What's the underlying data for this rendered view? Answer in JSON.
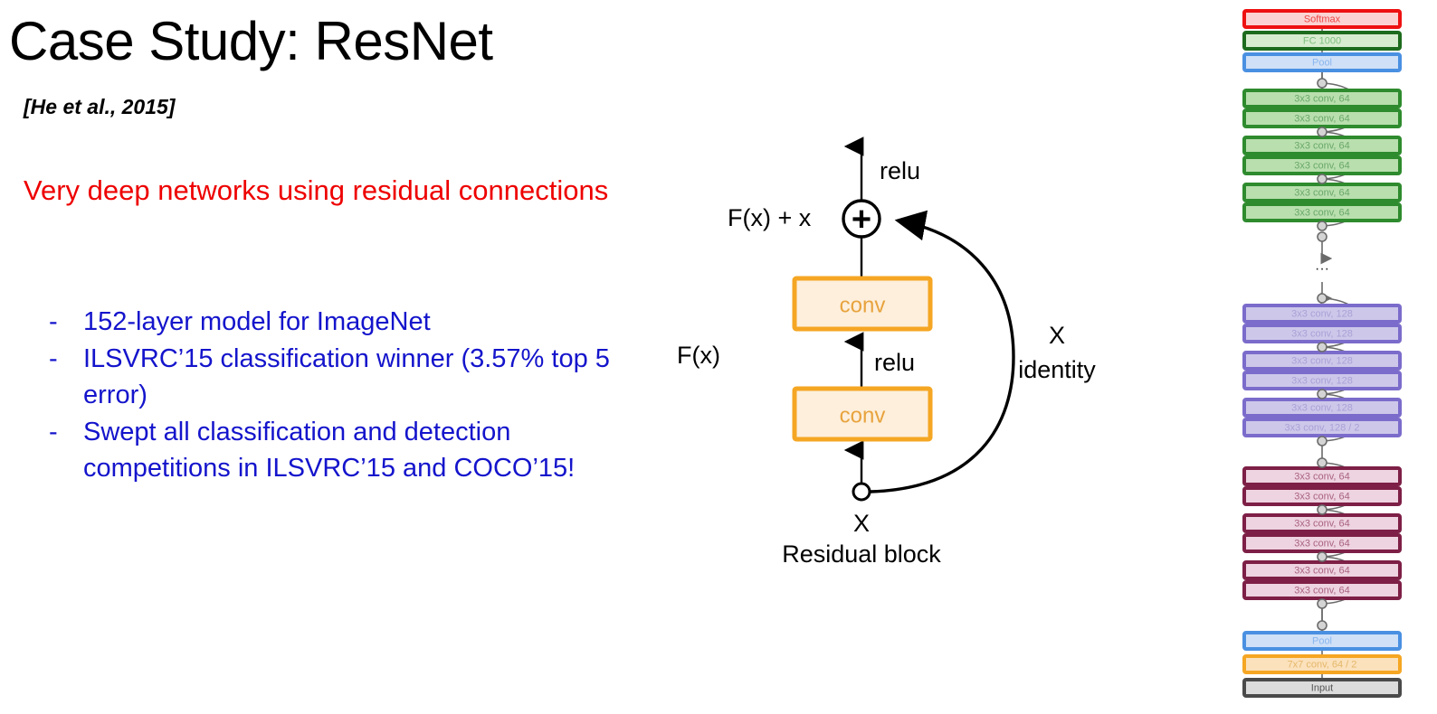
{
  "slide": {
    "title": "Case Study: ResNet",
    "citation": "[He et al., 2015]",
    "headline": "Very deep networks using residual connections",
    "bullet_marker": "-",
    "bullets": [
      "152-layer model for ImageNet",
      "ILSVRC’15 classification winner (3.57% top 5 error)",
      "Swept all classification and detection competitions in ILSVRC’15 and COCO’15!"
    ],
    "colors": {
      "title": "#000000",
      "headline": "#ee0000",
      "bullets": "#1414cc"
    }
  },
  "residual_block": {
    "caption": "Residual block",
    "input_label": "X",
    "output_relu_label": "relu",
    "mid_relu_label": "relu",
    "sum_label": "F(x) + x",
    "branch_label": "F(x)",
    "identity_label_top": "X",
    "identity_label_bottom": "identity",
    "conv_top_label": "conv",
    "conv_bottom_label": "conv",
    "plus_glyph": "+",
    "colors": {
      "conv_border": "#f5a623",
      "conv_fill": "#fdefdc",
      "conv_text": "#e8a33d",
      "line": "#000000"
    }
  },
  "architecture": {
    "ellipsis": "···",
    "palettes": {
      "softmax": {
        "border": "#ee1111",
        "fill": "#fbd3d3",
        "text": "#ee4444"
      },
      "fc": {
        "border": "#1d6b1d",
        "fill": "#d8ecd0",
        "text": "#7fbf7f"
      },
      "pool": {
        "border": "#4a90e2",
        "fill": "#cfe0f7",
        "text": "#8ab6ef"
      },
      "green": {
        "border": "#2e8b2e",
        "fill": "#b9dfae",
        "text": "#6aa86a"
      },
      "purple": {
        "border": "#7b6ccb",
        "fill": "#cdc8ea",
        "text": "#a9a1d6"
      },
      "maroon": {
        "border": "#7d1f46",
        "fill": "#eed3e0",
        "text": "#a96382"
      },
      "orange": {
        "border": "#f5a623",
        "fill": "#fbe1bc",
        "text": "#e5b86a"
      },
      "input": {
        "border": "#4a4a4a",
        "fill": "#dcdcdc",
        "text": "#555555"
      }
    },
    "layers": [
      {
        "label": "Softmax",
        "style": "softmax"
      },
      {
        "label": "FC 1000",
        "style": "fc"
      },
      {
        "label": "Pool",
        "style": "pool"
      },
      {
        "label": "3x3 conv, 64",
        "style": "green"
      },
      {
        "label": "3x3 conv, 64",
        "style": "green"
      },
      {
        "label": "3x3 conv, 64",
        "style": "green"
      },
      {
        "label": "3x3 conv, 64",
        "style": "green"
      },
      {
        "label": "3x3 conv, 64",
        "style": "green"
      },
      {
        "label": "3x3 conv, 64",
        "style": "green"
      },
      {
        "label": "3x3 conv, 128",
        "style": "purple"
      },
      {
        "label": "3x3 conv, 128",
        "style": "purple"
      },
      {
        "label": "3x3 conv, 128",
        "style": "purple"
      },
      {
        "label": "3x3 conv, 128",
        "style": "purple"
      },
      {
        "label": "3x3 conv, 128",
        "style": "purple"
      },
      {
        "label": "3x3 conv, 128 / 2",
        "style": "purple"
      },
      {
        "label": "3x3 conv, 64",
        "style": "maroon"
      },
      {
        "label": "3x3 conv, 64",
        "style": "maroon"
      },
      {
        "label": "3x3 conv, 64",
        "style": "maroon"
      },
      {
        "label": "3x3 conv, 64",
        "style": "maroon"
      },
      {
        "label": "3x3 conv, 64",
        "style": "maroon"
      },
      {
        "label": "3x3 conv, 64",
        "style": "maroon"
      },
      {
        "label": "Pool",
        "style": "pool"
      },
      {
        "label": "7x7 conv, 64 / 2",
        "style": "orange"
      },
      {
        "label": "Input",
        "style": "input"
      }
    ]
  }
}
